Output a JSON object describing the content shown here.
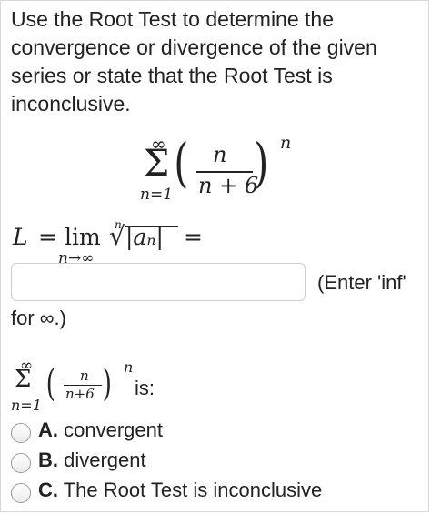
{
  "prompt": "Use the Root Test to determine the convergence or divergence of the given series or state that the Root Test is inconclusive.",
  "series_display": {
    "sum_upper": "∞",
    "sigma": "Σ",
    "sum_lower": "n=1",
    "numerator": "n",
    "denominator": "n + 6",
    "exponent": "n"
  },
  "limit_expr": {
    "L": "L",
    "equals": "=",
    "lim": "lim",
    "lim_sub": "n→∞",
    "root_index": "n",
    "radical": "√",
    "abs_term": "|aₙ|",
    "trailing_equals": "="
  },
  "answer_input": {
    "value": "",
    "placeholder": ""
  },
  "hint_line1": "(Enter 'inf'",
  "hint_line2": "for ∞.)",
  "series_small": {
    "sum_upper": "∞",
    "sigma": "Σ",
    "sum_lower": "n=1",
    "numerator": "n",
    "denominator": "n+6",
    "exponent": "n",
    "suffix": "is:"
  },
  "options": [
    {
      "letter": "A.",
      "text": "convergent"
    },
    {
      "letter": "B.",
      "text": "divergent"
    },
    {
      "letter": "C.",
      "text": "The Root Test is inconclusive"
    }
  ]
}
